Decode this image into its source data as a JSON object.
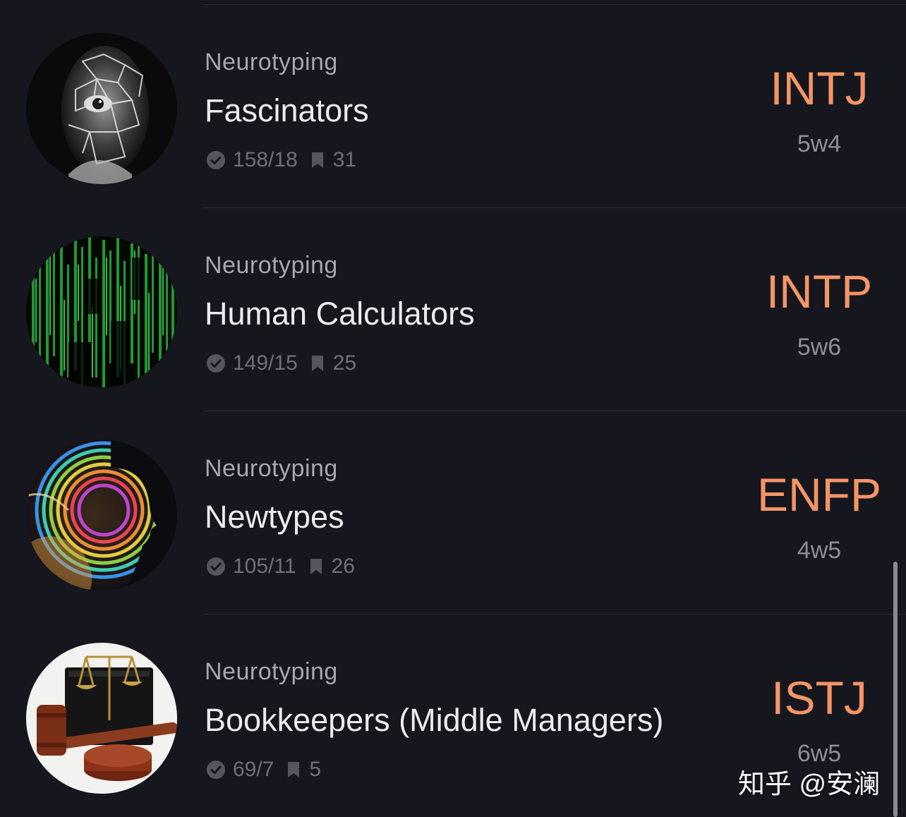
{
  "colors": {
    "background": "#16161e",
    "mbti_accent": "#f39566",
    "title_text": "#ececf0",
    "secondary_text": "#a6a6ad",
    "muted_text": "#6f6f77",
    "divider": "#2c2c34"
  },
  "icons": {
    "stats_votes": "check-circle-icon",
    "stats_bookmarks": "bookmark-icon"
  },
  "items": [
    {
      "category": "Neurotyping",
      "title": "Fascinators",
      "votes": "158/18",
      "bookmarks": "31",
      "mbti": "INTJ",
      "enneagram": "5w4",
      "avatar": "shattered-face-portrait"
    },
    {
      "category": "Neurotyping",
      "title": "Human Calculators",
      "votes": "149/15",
      "bookmarks": "25",
      "mbti": "INTP",
      "enneagram": "5w6",
      "avatar": "green-matrix-code"
    },
    {
      "category": "Neurotyping",
      "title": "Newtypes",
      "votes": "105/11",
      "bookmarks": "26",
      "mbti": "ENFP",
      "enneagram": "4w5",
      "avatar": "rainbow-head-silhouette"
    },
    {
      "category": "Neurotyping",
      "title": "Bookkeepers (Middle Managers)",
      "votes": "69/7",
      "bookmarks": "5",
      "mbti": "ISTJ",
      "enneagram": "6w5",
      "avatar": "scales-and-gavel"
    }
  ],
  "watermark": "知乎 @安澜"
}
